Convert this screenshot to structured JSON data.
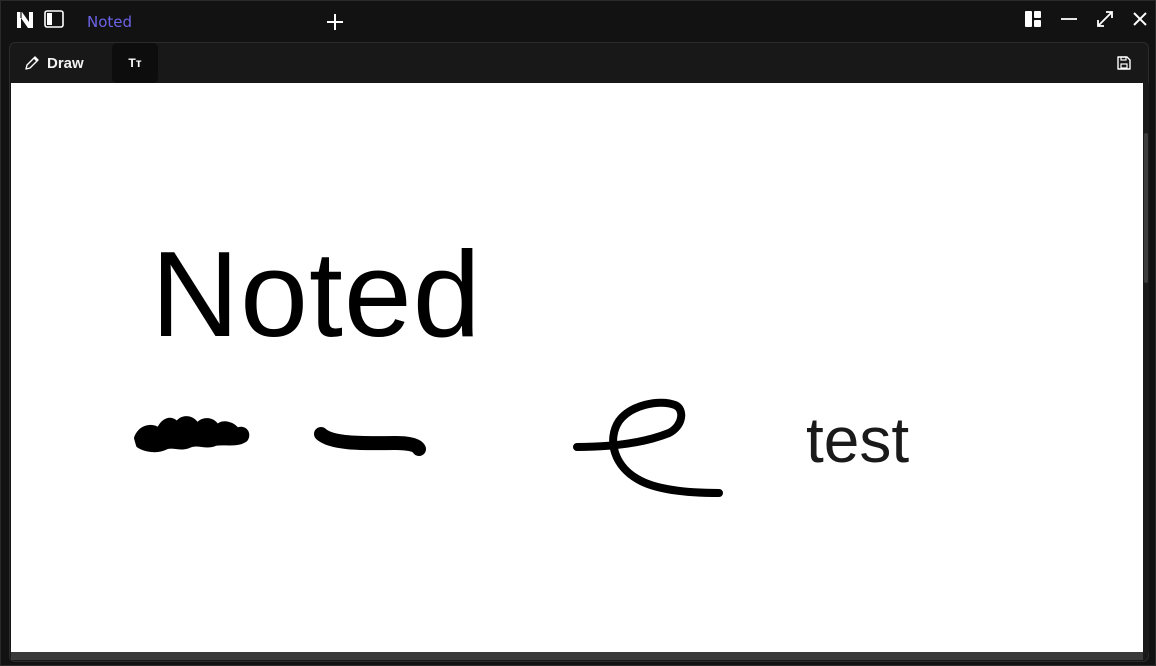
{
  "app": {
    "tab_title": "Noted"
  },
  "toolbar": {
    "draw_label": "Draw",
    "text_tool_label": "Tт"
  },
  "canvas": {
    "heading_text": "Noted",
    "small_text": "test"
  },
  "icons": {
    "logo": "noted-logo-icon",
    "sidebar": "sidebar-toggle-icon",
    "new_tab": "plus-icon",
    "layout": "layout-icon",
    "minimize": "minimize-icon",
    "maximize": "maximize-icon",
    "close": "close-icon",
    "pencil": "pencil-icon",
    "save": "save-icon"
  },
  "colors": {
    "accent": "#6b63e6",
    "background": "#121212",
    "canvas": "#ffffff"
  }
}
